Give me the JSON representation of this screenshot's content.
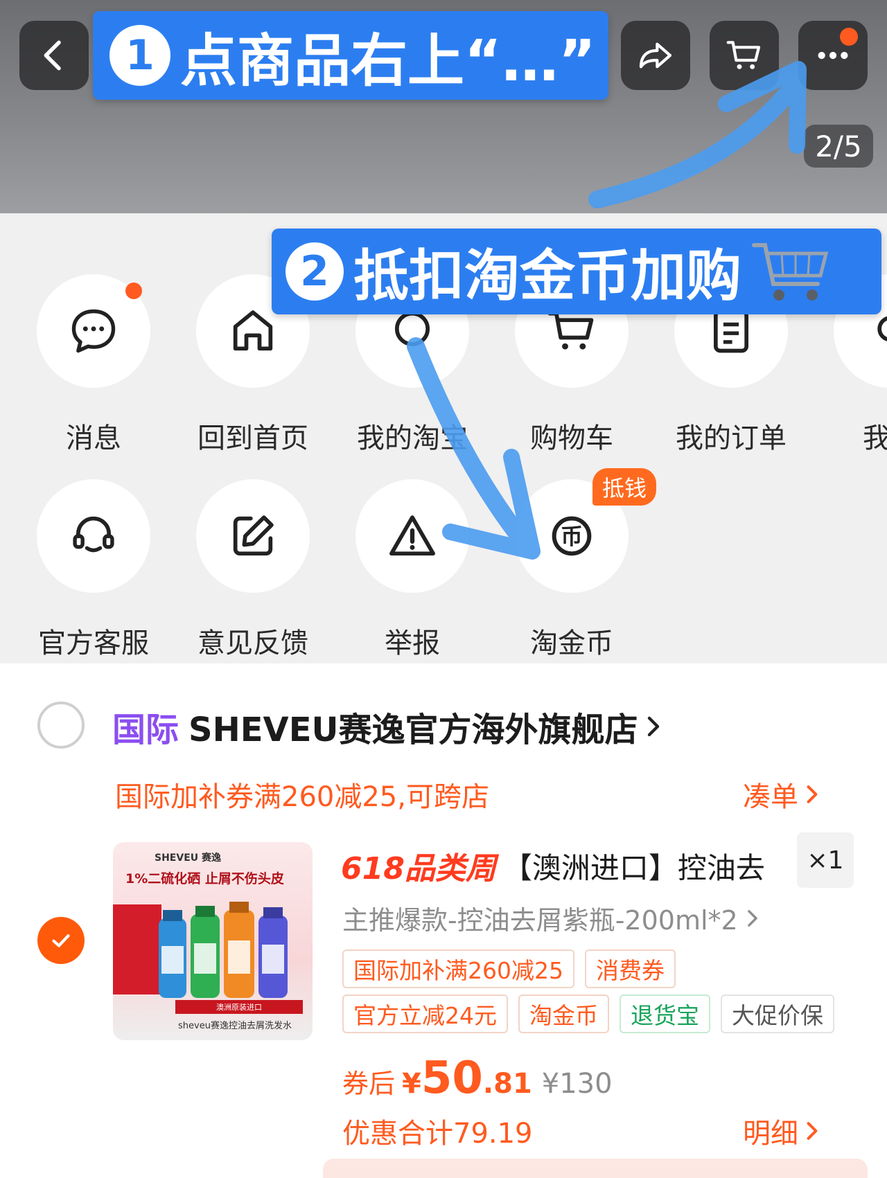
{
  "header": {
    "page_counter": "2/5",
    "callout_1": {
      "num": "1",
      "text": "点商品右上“…”"
    },
    "callout_2": {
      "num": "2",
      "text": "抵扣淘金币加购"
    }
  },
  "menu": {
    "row1": [
      {
        "label": "消息",
        "icon": "message-icon"
      },
      {
        "label": "回到首页",
        "icon": "home-icon"
      },
      {
        "label": "我的淘宝",
        "icon": "profile-icon"
      },
      {
        "label": "购物车",
        "icon": "cart-icon"
      },
      {
        "label": "我的订单",
        "icon": "order-icon"
      },
      {
        "label": "我的",
        "icon": "partial-icon"
      }
    ],
    "row2": [
      {
        "label": "官方客服",
        "icon": "headset-icon"
      },
      {
        "label": "意见反馈",
        "icon": "edit-icon"
      },
      {
        "label": "举报",
        "icon": "warning-icon"
      },
      {
        "label": "淘金币",
        "icon": "coin-icon",
        "badge": "抵钱"
      }
    ]
  },
  "cart": {
    "store_intl": "国际",
    "store_name": "SHEVEU赛逸官方海外旗舰店",
    "coupon_text": "国际加补券满260减25,可跨店",
    "coudan": "凑单",
    "product": {
      "image_brand": "SHEVEU 赛逸",
      "image_line": "1%二硫化硒 止屑不伤头皮",
      "image_banner": "澳洲原装进口",
      "image_bottom": "sheveu赛逸控油去屑洗发水",
      "promo": "618品类周",
      "title": "【澳洲进口】控油去",
      "qty": "×1",
      "variant": "主推爆款-控油去屑紫瓶-200ml*2",
      "tags": [
        "国际加补满260减25",
        "消费券",
        "官方立减24元",
        "淘金币",
        "退货宝",
        "大促价保"
      ],
      "price_label": "券后",
      "price_currency": "¥",
      "price_int": "50",
      "price_dec": ".81",
      "price_orig": "¥130",
      "discount_total": "优惠合计79.19",
      "detail": "明细"
    }
  },
  "colors": {
    "accent": "#ff5a1f",
    "callout": "#2c7ef0",
    "intl_purple": "#8b4ef0",
    "green": "#19a45a"
  }
}
